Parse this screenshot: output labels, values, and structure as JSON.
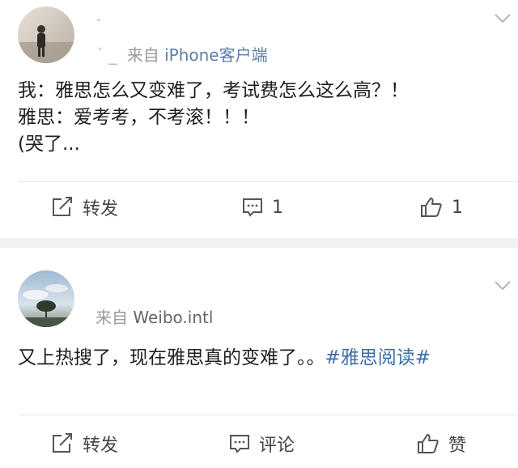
{
  "posts": [
    {
      "source_prefix": "来自",
      "source_device": "iPhone客户端",
      "content_lines": [
        "我：雅思怎么又变难了，考试费怎么这么高？！",
        "雅思：爱考考，不考滚！！！",
        "(哭了..."
      ],
      "actions": {
        "repost_label": "转发",
        "comment_count": "1",
        "like_count": "1"
      }
    },
    {
      "source_prefix": "来自",
      "source_device": "Weibo.intl",
      "content_text": "又上热搜了，现在雅思真的变难了。。",
      "content_tag": "#雅思阅读#",
      "actions": {
        "repost_label": "转发",
        "comment_label": "评论",
        "like_label": "赞"
      }
    }
  ],
  "colors": {
    "link_blue": "#3b6fa8",
    "separator": "#f2f2f2"
  },
  "icons": [
    "menu-chevron-icon",
    "repost-icon",
    "comment-icon",
    "like-icon"
  ]
}
